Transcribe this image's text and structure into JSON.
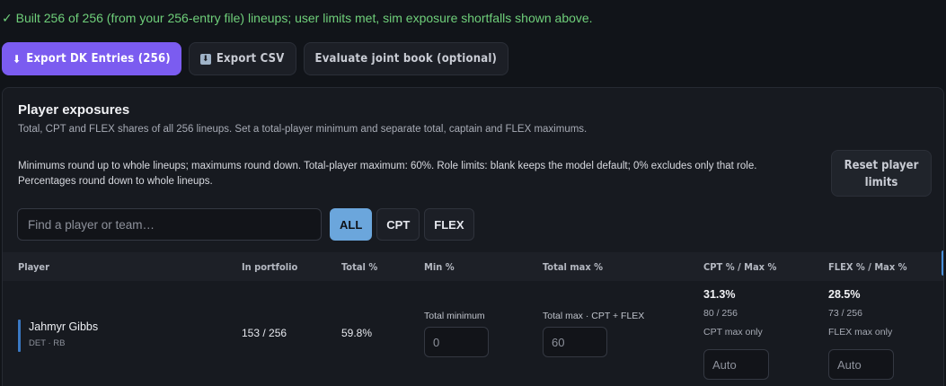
{
  "status": {
    "message": "✓ Built 256 of 256 (from your 256-entry file) lineups; user limits met, sim exposure shortfalls shown above."
  },
  "actions": {
    "export_dk_label": "Export DK Entries (256)",
    "export_csv_label": "Export CSV",
    "evaluate_label": "Evaluate joint book (optional)"
  },
  "panel": {
    "title": "Player exposures",
    "subtitle": "Total, CPT and FLEX shares of all 256 lineups. Set a total-player minimum and separate total, captain and FLEX maximums.",
    "note_line1": "Minimums round up to whole lineups; maximums round down. Total-player maximum: 60%. Role limits: blank keeps the model default; 0% excludes only that role.",
    "note_line2": "Percentages round down to whole lineups.",
    "reset_line1": "Reset player",
    "reset_line2": "limits",
    "search_placeholder": "Find a player or team…",
    "search_value": "",
    "filters": [
      "ALL",
      "CPT",
      "FLEX"
    ],
    "active_filter": "ALL"
  },
  "table": {
    "columns": [
      "Player",
      "In portfolio",
      "Total %",
      "Min %",
      "Total max %",
      "CPT % / Max %",
      "FLEX % / Max %"
    ],
    "rows": [
      {
        "name": "Jahmyr Gibbs",
        "meta": "DET · RB",
        "in_portfolio": "153 / 256",
        "total_pct": "59.8%",
        "min_label": "Total minimum",
        "min_placeholder": "0",
        "max_label": "Total max · CPT + FLEX",
        "max_placeholder": "60",
        "cpt_pct": "31.3%",
        "cpt_count": "80 / 256",
        "cpt_label": "CPT max only",
        "cpt_placeholder": "Auto",
        "flex_pct": "28.5%",
        "flex_count": "73 / 256",
        "flex_label": "FLEX max only",
        "flex_placeholder": "Auto"
      }
    ]
  },
  "colors": {
    "accent_purple": "#7b5cf0",
    "active_filter": "#6ba6dc",
    "success_green": "#6fcf7a"
  },
  "icons": [
    "download-arrow-icon",
    "save-disk-icon"
  ]
}
